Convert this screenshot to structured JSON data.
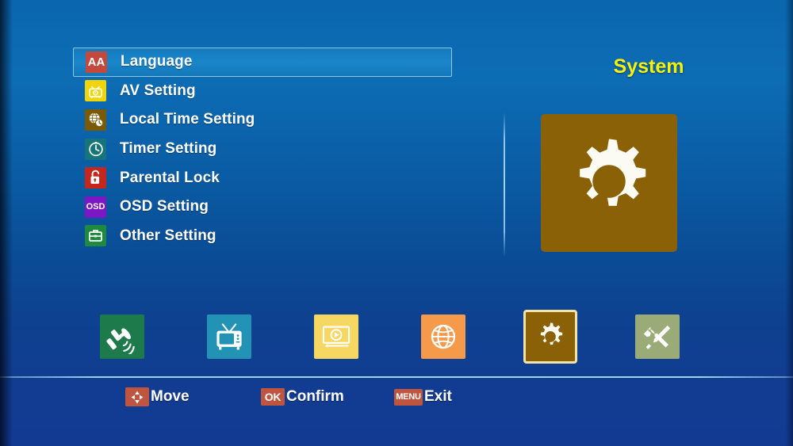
{
  "menu": {
    "items": [
      {
        "label": "Language",
        "icon": "language-icon",
        "icon_text": "AA",
        "tile_color": "#c4483c",
        "selected": true
      },
      {
        "label": "AV Setting",
        "icon": "av-setting-icon",
        "icon_text": "",
        "tile_color": "#f0d50a",
        "selected": false
      },
      {
        "label": "Local Time Setting",
        "icon": "local-time-icon",
        "icon_text": "",
        "tile_color": "#7a5a06",
        "selected": false
      },
      {
        "label": "Timer Setting",
        "icon": "timer-icon",
        "icon_text": "",
        "tile_color": "#16757a",
        "selected": false
      },
      {
        "label": "Parental Lock",
        "icon": "padlock-icon",
        "icon_text": "",
        "tile_color": "#c5271d",
        "selected": false
      },
      {
        "label": "OSD Setting",
        "icon": "osd-icon",
        "icon_text": "OSD",
        "tile_color": "#7d16c4",
        "selected": false
      },
      {
        "label": "Other Setting",
        "icon": "briefcase-icon",
        "icon_text": "",
        "tile_color": "#1d8a3f",
        "selected": false
      }
    ]
  },
  "panel": {
    "title": "System",
    "icon": "gear-icon",
    "tile_color": "#8a6107"
  },
  "dock": {
    "items": [
      {
        "name": "dock-item-installation",
        "icon": "satellite-dish-icon",
        "tile_color": "#1d7a4a",
        "active": false
      },
      {
        "name": "dock-item-channel",
        "icon": "television-icon",
        "tile_color": "#2292b5",
        "active": false
      },
      {
        "name": "dock-item-media",
        "icon": "media-player-icon",
        "tile_color": "#f5d761",
        "active": false
      },
      {
        "name": "dock-item-network",
        "icon": "globe-icon",
        "tile_color": "#f59a4b",
        "active": false
      },
      {
        "name": "dock-item-system",
        "icon": "gear-icon",
        "tile_color": "#8a6107",
        "active": true
      },
      {
        "name": "dock-item-tools",
        "icon": "tools-icon",
        "tile_color": "#9aab78",
        "active": false
      }
    ]
  },
  "footer": {
    "hints": [
      {
        "key": "dpad",
        "key_label": "",
        "label": "Move"
      },
      {
        "key": "ok",
        "key_label": "OK",
        "label": "Confirm"
      },
      {
        "key": "menu",
        "key_label": "MENU",
        "label": "Exit"
      }
    ]
  },
  "colors": {
    "accent_yellow": "#f5f10c",
    "highlight_blue": "#1a86ca",
    "key_red": "#c0553f"
  }
}
